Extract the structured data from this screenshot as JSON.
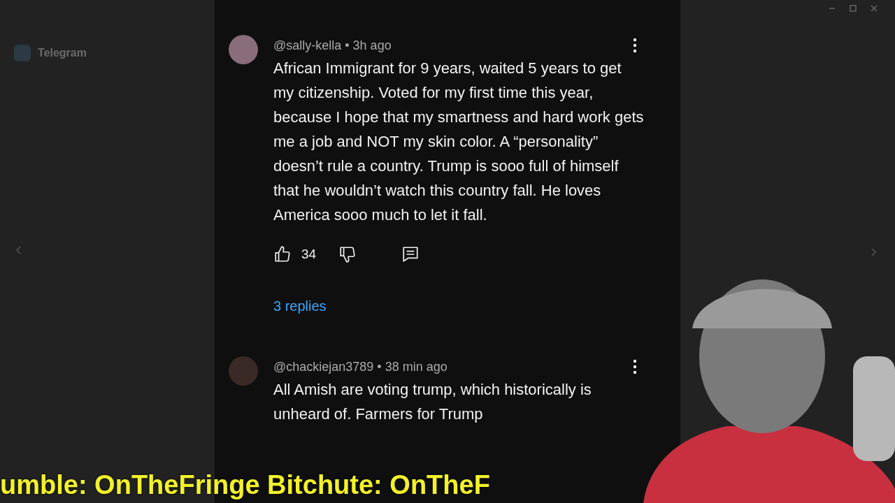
{
  "side_panel": {
    "app_name": "Telegram"
  },
  "comments": [
    {
      "meta": "@sally-kella • 3h ago",
      "text": "African Immigrant for 9 years, waited 5 years to get my citizenship. Voted for my first time this year, because I hope that my smartness and hard work gets me a job and NOT my skin color. A “personality” doesn’t rule a country. Trump is sooo full of himself that he wouldn’t watch this country fall. He loves America sooo much to let it fall.",
      "likes": "34",
      "replies": "3 replies"
    },
    {
      "meta": "@chackiejan3789 • 38 min ago",
      "text": "All Amish are voting trump, which historically is unheard of. Farmers for Trump"
    }
  ],
  "ticker": "umble: OnTheFringe Bitchute: OnTheF"
}
